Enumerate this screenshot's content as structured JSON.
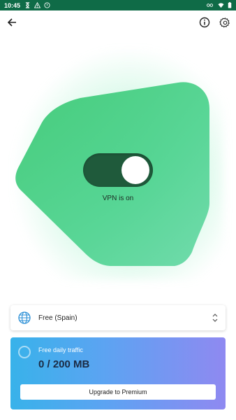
{
  "status_bar": {
    "time": "10:45",
    "left_icons": [
      "hourglass-icon",
      "warning-icon",
      "shield-icon"
    ],
    "right_icons": [
      "vpn-key-icon",
      "wifi-icon",
      "battery-icon"
    ],
    "background_color": "#0f6b47"
  },
  "toolbar": {
    "back_icon": "arrow-back-icon",
    "info_icon": "info-icon",
    "settings_icon": "gear-icon"
  },
  "vpn": {
    "toggle_on": true,
    "status_text": "VPN is on",
    "accent_color": "#1f5a3b",
    "hero_color": "#4cd98e"
  },
  "location": {
    "icon": "globe-icon",
    "label": "Free (Spain)",
    "chevron": "unfold-chevron-icon"
  },
  "traffic": {
    "title": "Free daily traffic",
    "value": "0 / 200 MB",
    "used_fraction": 0,
    "upgrade_label": "Upgrade to Premium",
    "gradient_start": "#38b2ea",
    "gradient_end": "#8f89f1"
  }
}
